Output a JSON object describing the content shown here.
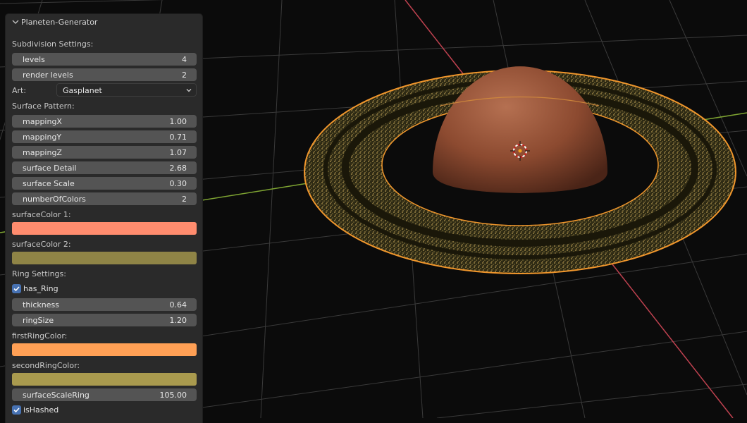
{
  "panel": {
    "title": "Planeten-Generator",
    "subdivision_heading": "Subdivision Settings:",
    "levels": {
      "name": "levels",
      "value": "4"
    },
    "render_levels": {
      "name": "render levels",
      "value": "2"
    },
    "art": {
      "label": "Art:",
      "value": "Gasplanet"
    },
    "surface_heading": "Surface Pattern:",
    "mappingX": {
      "name": "mappingX",
      "value": "1.00"
    },
    "mappingY": {
      "name": "mappingY",
      "value": "0.71"
    },
    "mappingZ": {
      "name": "mappingZ",
      "value": "1.07"
    },
    "surface_detail": {
      "name": "surface Detail",
      "value": "2.68"
    },
    "surface_scale": {
      "name": "surface Scale",
      "value": "0.30"
    },
    "number_of_colors": {
      "name": "numberOfColors",
      "value": "2"
    },
    "surface_color_1": {
      "label": "surfaceColor 1:",
      "color": "#ff8c6e"
    },
    "surface_color_2": {
      "label": "surfaceColor 2:",
      "color": "#8f8446"
    },
    "ring_heading": "Ring Settings:",
    "has_ring": {
      "label": "has_Ring",
      "checked": true
    },
    "thickness": {
      "name": "thickness",
      "value": "0.64"
    },
    "ring_size": {
      "name": "ringSize",
      "value": "1.20"
    },
    "first_ring_color": {
      "label": "firstRingColor:",
      "color": "#ffa055"
    },
    "second_ring_color": {
      "label": "secondRingColor:",
      "color": "#a99a4e"
    },
    "surface_scale_ring": {
      "name": "surfaceScaleRing",
      "value": "105.00"
    },
    "is_hashed": {
      "label": "isHashed",
      "checked": true
    }
  },
  "colors": {
    "panel_bg": "#2a2a2a",
    "field_bg": "#545454",
    "checkbox_accent": "#4772b3",
    "selection_outline": "#f0962c",
    "x_axis": "#c04250",
    "y_axis": "#7fa532",
    "viewport_bg": "#0b0b0b",
    "grid": "#3a3a3a"
  }
}
